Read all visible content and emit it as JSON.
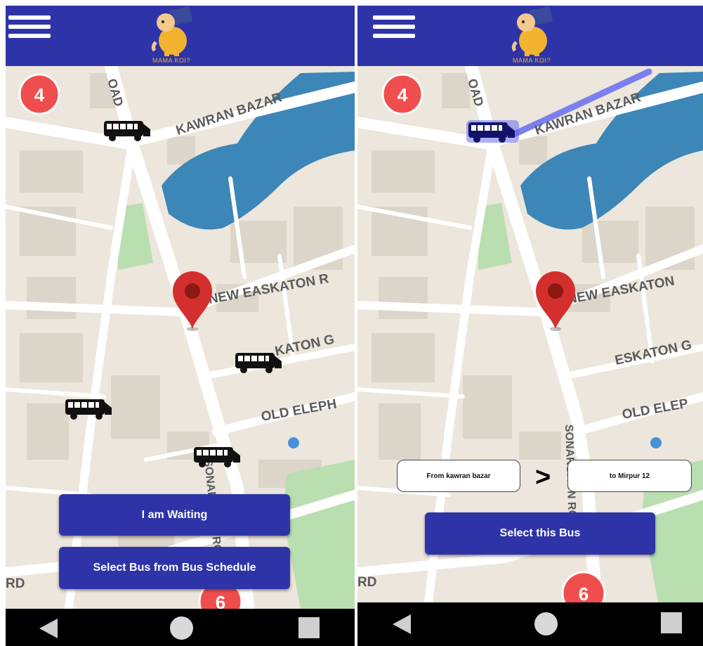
{
  "app": {
    "logo_text": "MAMA KOI?"
  },
  "left_screen": {
    "map_badge_top": "4",
    "map_badge_bottom": "6",
    "street_labels": {
      "kawran": "KAWRAN BAZAR",
      "road_top": "OAD",
      "new_eskaton": "NEW EASKATON R",
      "eskaton_garden": "KATON G",
      "old_elephant": "OLD ELEPH",
      "road_bottom_left": "RD",
      "vertical_road": "SONARGAON ROAD"
    },
    "buttons": {
      "waiting": "I am Waiting",
      "select_schedule": "Select Bus from Bus Schedule"
    }
  },
  "right_screen": {
    "map_badge_top": "4",
    "map_badge_bottom": "6",
    "street_labels": {
      "kawran": "KAWRAN BAZAR",
      "road_top": "OAD",
      "new_eskaton": "NEW EASKATON",
      "eskaton": "ESKATON G",
      "old_elephant": "OLD ELEP",
      "road_bottom_left": "RD",
      "vertical_road": "SONARGAON ROAD"
    },
    "route": {
      "from": "From kawran bazar",
      "arrow": ">",
      "to": "to Mirpur 12"
    },
    "buttons": {
      "select_bus": "Select this Bus"
    }
  },
  "colors": {
    "primary": "#2e34a8",
    "marker": "#d32f2f",
    "badge": "#f04e4e",
    "route_line": "#7b7ff0",
    "water": "#3c86b8",
    "park": "#b9deb0"
  },
  "icons": {
    "menu": "hamburger-icon",
    "bus": "bus-icon",
    "marker": "location-pin-icon",
    "nav_back": "back-triangle-icon",
    "nav_home": "home-circle-icon",
    "nav_recent": "recent-square-icon"
  }
}
